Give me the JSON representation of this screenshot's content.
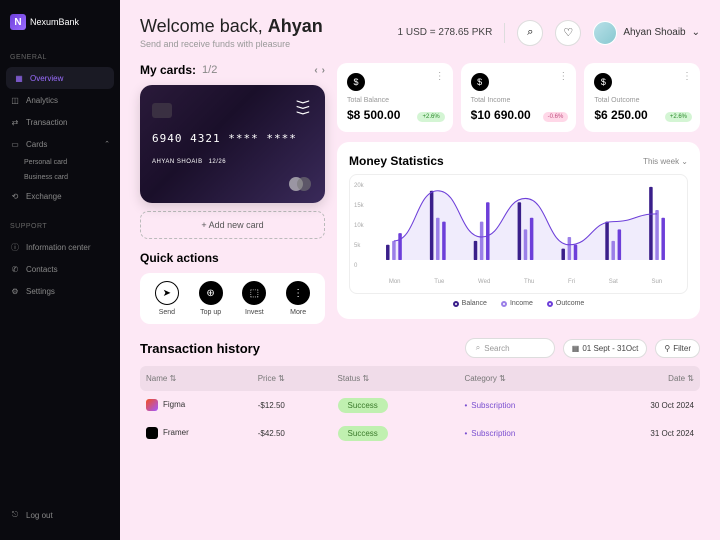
{
  "brand": "NexumBank",
  "sidebar": {
    "sections": [
      {
        "label": "GENERAL",
        "items": [
          {
            "label": "Overview",
            "icon": "grid",
            "active": true
          },
          {
            "label": "Analytics",
            "icon": "chart"
          },
          {
            "label": "Transaction",
            "icon": "swap"
          },
          {
            "label": "Cards",
            "icon": "card",
            "expanded": true,
            "children": [
              {
                "label": "Personal card"
              },
              {
                "label": "Business card"
              }
            ]
          },
          {
            "label": "Exchange",
            "icon": "refresh"
          }
        ]
      },
      {
        "label": "SUPPORT",
        "items": [
          {
            "label": "Information center",
            "icon": "info"
          },
          {
            "label": "Contacts",
            "icon": "phone"
          },
          {
            "label": "Settings",
            "icon": "gear"
          }
        ]
      }
    ],
    "logout": "Log out"
  },
  "header": {
    "welcome_prefix": "Welcome back, ",
    "user_first": "Ahyan",
    "subtitle": "Send and receive funds with pleasure",
    "rate": "1 USD = 278.65 PKR",
    "user_full": "Ahyan Shoaib"
  },
  "cards": {
    "title": "My cards:",
    "count": "1/2",
    "number": "6940  4321 **** ****",
    "holder": "AHYAN SHOAIB",
    "exp": "12/26",
    "add": "+  Add new card"
  },
  "stats": [
    {
      "label": "Total Balance",
      "value": "$8 500.00",
      "badge": "+2.6%",
      "badge_type": "green"
    },
    {
      "label": "Total Income",
      "value": "$10 690.00",
      "badge": "-0.6%",
      "badge_type": "pink"
    },
    {
      "label": "Total Outcome",
      "value": "$6 250.00",
      "badge": "+2.6%",
      "badge_type": "green"
    }
  ],
  "chart_data": {
    "type": "bar",
    "title": "Money Statistics",
    "period": "This week ⌄",
    "yticks": [
      "20k",
      "15k",
      "10k",
      "5k",
      "0"
    ],
    "categories": [
      "Mon",
      "Tue",
      "Wed",
      "Thu",
      "Fri",
      "Sat",
      "Sun"
    ],
    "series": [
      {
        "name": "Balance",
        "color": "#3a1f8a",
        "values": [
          4,
          18,
          5,
          15,
          3,
          10,
          19
        ]
      },
      {
        "name": "Income",
        "color": "#9b7fe8",
        "values": [
          5,
          11,
          10,
          8,
          6,
          5,
          13
        ]
      },
      {
        "name": "Outcome",
        "color": "#6d3fd9",
        "values": [
          7,
          10,
          15,
          11,
          4,
          8,
          11
        ]
      }
    ],
    "curve": [
      5,
      18,
      6,
      16,
      4,
      10,
      12
    ],
    "ylim": [
      0,
      20
    ]
  },
  "quick": {
    "title": "Quick actions",
    "items": [
      {
        "label": "Send",
        "icon": "➤"
      },
      {
        "label": "Top up",
        "icon": "⊕"
      },
      {
        "label": "Invest",
        "icon": "⬚"
      },
      {
        "label": "More",
        "icon": "⋮"
      }
    ]
  },
  "history": {
    "title": "Transaction history",
    "search_ph": "Search",
    "date_range": "01 Sept - 31Oct",
    "filter": "Filter",
    "columns": [
      "Name",
      "Price",
      "Status",
      "Category",
      "Date"
    ],
    "rows": [
      {
        "name": "Figma",
        "icon": "figma",
        "price": "-$12.50",
        "status": "Success",
        "category": "Subscription",
        "date": "30 Oct 2024"
      },
      {
        "name": "Framer",
        "icon": "framer",
        "price": "-$42.50",
        "status": "Success",
        "category": "Subscription",
        "date": "31 Oct 2024"
      }
    ]
  }
}
